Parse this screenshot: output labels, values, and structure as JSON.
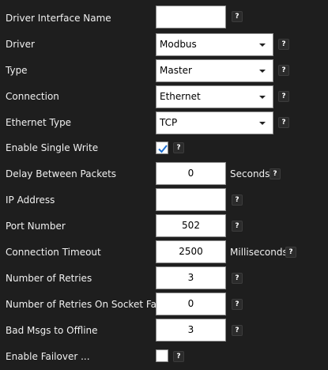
{
  "fields": {
    "driver_interface_name": {
      "label": "Driver Interface Name",
      "value": "",
      "help": "?"
    },
    "driver": {
      "label": "Driver",
      "value": "Modbus",
      "help": "?"
    },
    "type": {
      "label": "Type",
      "value": "Master",
      "help": "?"
    },
    "connection": {
      "label": "Connection",
      "value": "Ethernet",
      "help": "?"
    },
    "ethernet_type": {
      "label": "Ethernet Type",
      "value": "TCP",
      "help": "?"
    },
    "enable_single_write": {
      "label": "Enable Single Write",
      "checked": true,
      "help": "?"
    },
    "delay_between_packets": {
      "label": "Delay Between Packets",
      "value": "0",
      "unit": "Seconds",
      "help": "?"
    },
    "ip_address": {
      "label": "IP Address",
      "value": "",
      "help": "?"
    },
    "port_number": {
      "label": "Port Number",
      "value": "502",
      "help": "?"
    },
    "connection_timeout": {
      "label": "Connection Timeout",
      "value": "2500",
      "unit": "Milliseconds",
      "help": "?"
    },
    "number_of_retries": {
      "label": "Number of Retries",
      "value": "3",
      "help": "?"
    },
    "retries_on_socket_fail": {
      "label": "Number of Retries On Socket Fail",
      "value": "0",
      "help": "?"
    },
    "bad_msgs_to_offline": {
      "label": "Bad Msgs to Offline",
      "value": "3",
      "help": "?"
    },
    "enable_failover": {
      "label": "Enable Failover ...",
      "checked": false,
      "help": "?"
    }
  },
  "colors": {
    "background": "#1e1e1e",
    "check_accent": "#1e6fd0"
  }
}
